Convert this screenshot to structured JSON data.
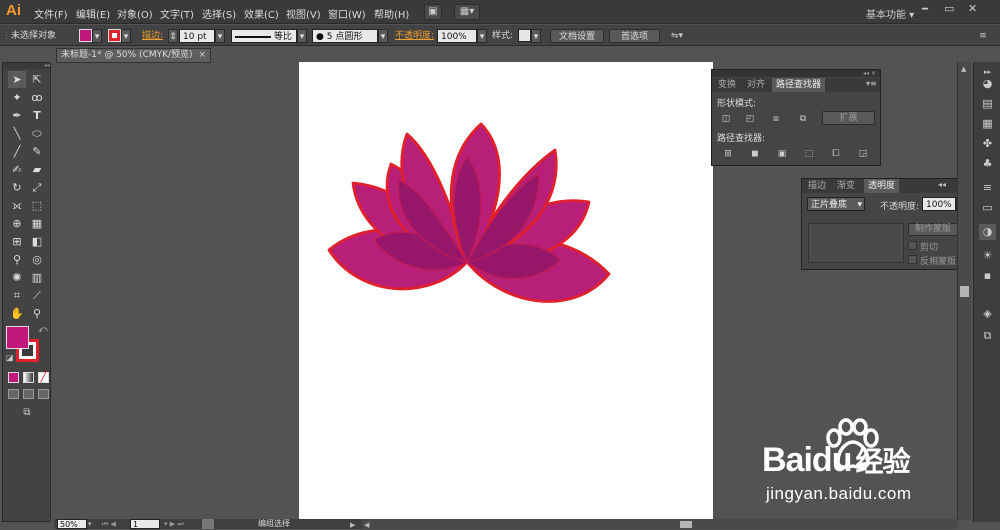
{
  "app": {
    "logo": "Ai",
    "workspace": "基本功能"
  },
  "menu": [
    "文件(F)",
    "编辑(E)",
    "对象(O)",
    "文字(T)",
    "选择(S)",
    "效果(C)",
    "视图(V)",
    "窗口(W)",
    "帮助(H)"
  ],
  "control": {
    "selection": "未选择对象",
    "stroke_label": "描边:",
    "stroke_weight": "10 pt",
    "stroke_profile": "等比",
    "brush": "5 点圆形",
    "opacity_label": "不透明度:",
    "opacity_value": "100%",
    "style_label": "样式:",
    "doc_setup": "文档设置",
    "prefs": "首选项"
  },
  "document": {
    "tab": "未标题-1* @ 50% (CMYK/预览)"
  },
  "colors": {
    "fill": "#c2187b",
    "stroke": "#e0202a",
    "petal_a": "#b81f79",
    "petal_b": "#96176a",
    "outline": "#e0202a"
  },
  "pathfinder": {
    "tabs": [
      "变换",
      "对齐",
      "路径查找器"
    ],
    "shape_modes": "形状模式:",
    "expand": "扩展",
    "pathfinders": "路径查找器:"
  },
  "transparency": {
    "tabs": [
      "描边",
      "渐变",
      "透明度"
    ],
    "blend": "正片叠底",
    "opacity_label": "不透明度:",
    "opacity_value": "100%",
    "make_mask": "制作蒙版",
    "clip": "剪切",
    "invert": "反相蒙版"
  },
  "status": {
    "zoom": "50%",
    "page": "1",
    "tool": "编组选择"
  },
  "watermark": {
    "brand_a": "Bai",
    "brand_b": "du",
    "brand_c": "经验",
    "url": "jingyan.baidu.com"
  }
}
